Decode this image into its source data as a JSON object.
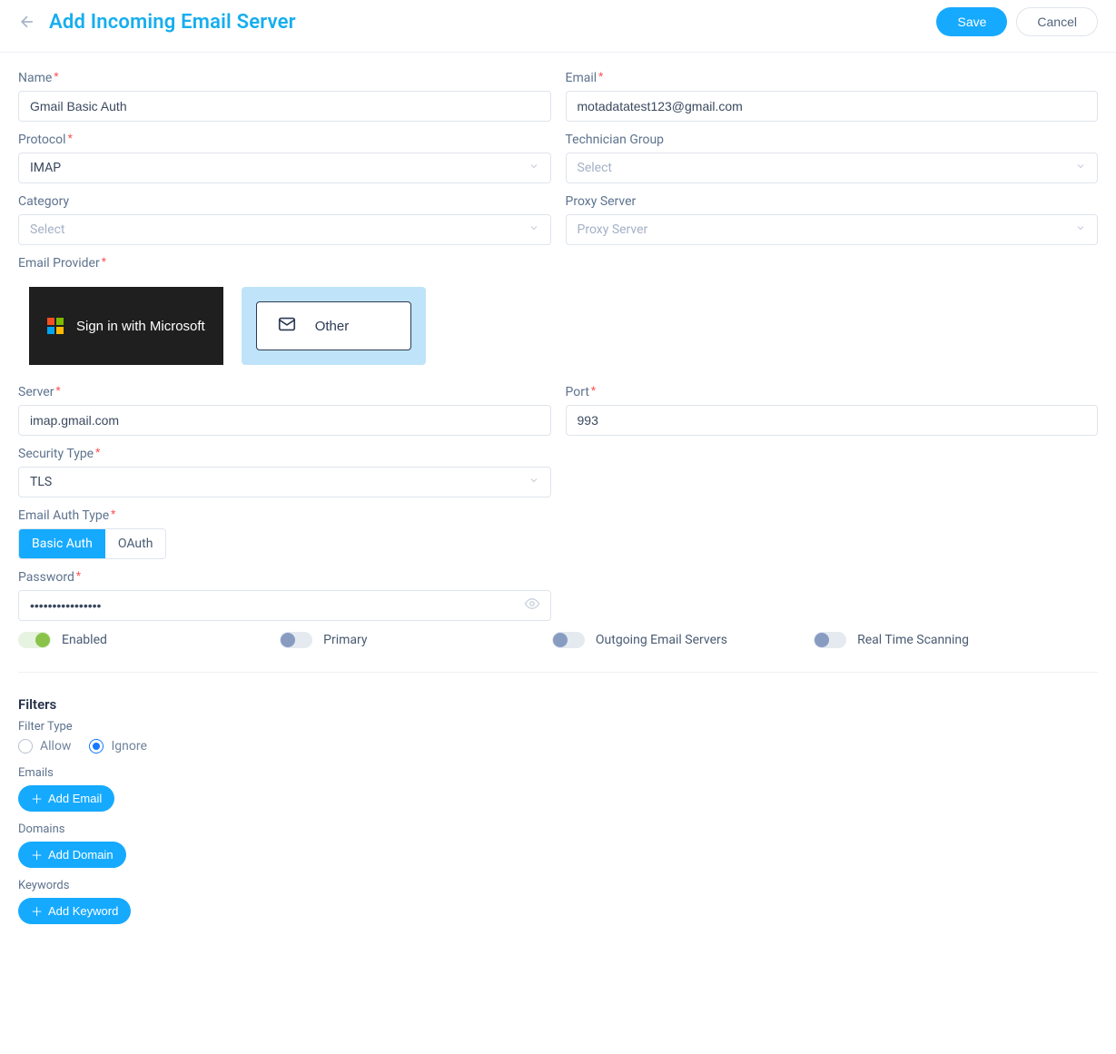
{
  "header": {
    "title": "Add Incoming Email Server",
    "save": "Save",
    "cancel": "Cancel"
  },
  "labels": {
    "name": "Name",
    "email": "Email",
    "protocol": "Protocol",
    "tech_group": "Technician Group",
    "category": "Category",
    "proxy": "Proxy Server",
    "provider": "Email Provider",
    "server": "Server",
    "port": "Port",
    "security": "Security Type",
    "auth_type": "Email Auth Type",
    "password": "Password",
    "filters": "Filters",
    "filter_type": "Filter Type",
    "emails": "Emails",
    "domains": "Domains",
    "keywords": "Keywords"
  },
  "values": {
    "name": "Gmail Basic Auth",
    "email": "motadatatest123@gmail.com",
    "protocol": "IMAP",
    "server": "imap.gmail.com",
    "port": "993",
    "security": "TLS",
    "password_mask": "••••••••••••••••"
  },
  "placeholders": {
    "select": "Select",
    "proxy": "Proxy Server"
  },
  "provider": {
    "microsoft": "Sign in with Microsoft",
    "other": "Other"
  },
  "auth": {
    "basic": "Basic Auth",
    "oauth": "OAuth"
  },
  "toggles": {
    "enabled": "Enabled",
    "primary": "Primary",
    "outgoing": "Outgoing Email Servers",
    "realtime": "Real Time Scanning"
  },
  "filter": {
    "allow": "Allow",
    "ignore": "Ignore",
    "add_email": "Add Email",
    "add_domain": "Add Domain",
    "add_keyword": "Add Keyword"
  }
}
